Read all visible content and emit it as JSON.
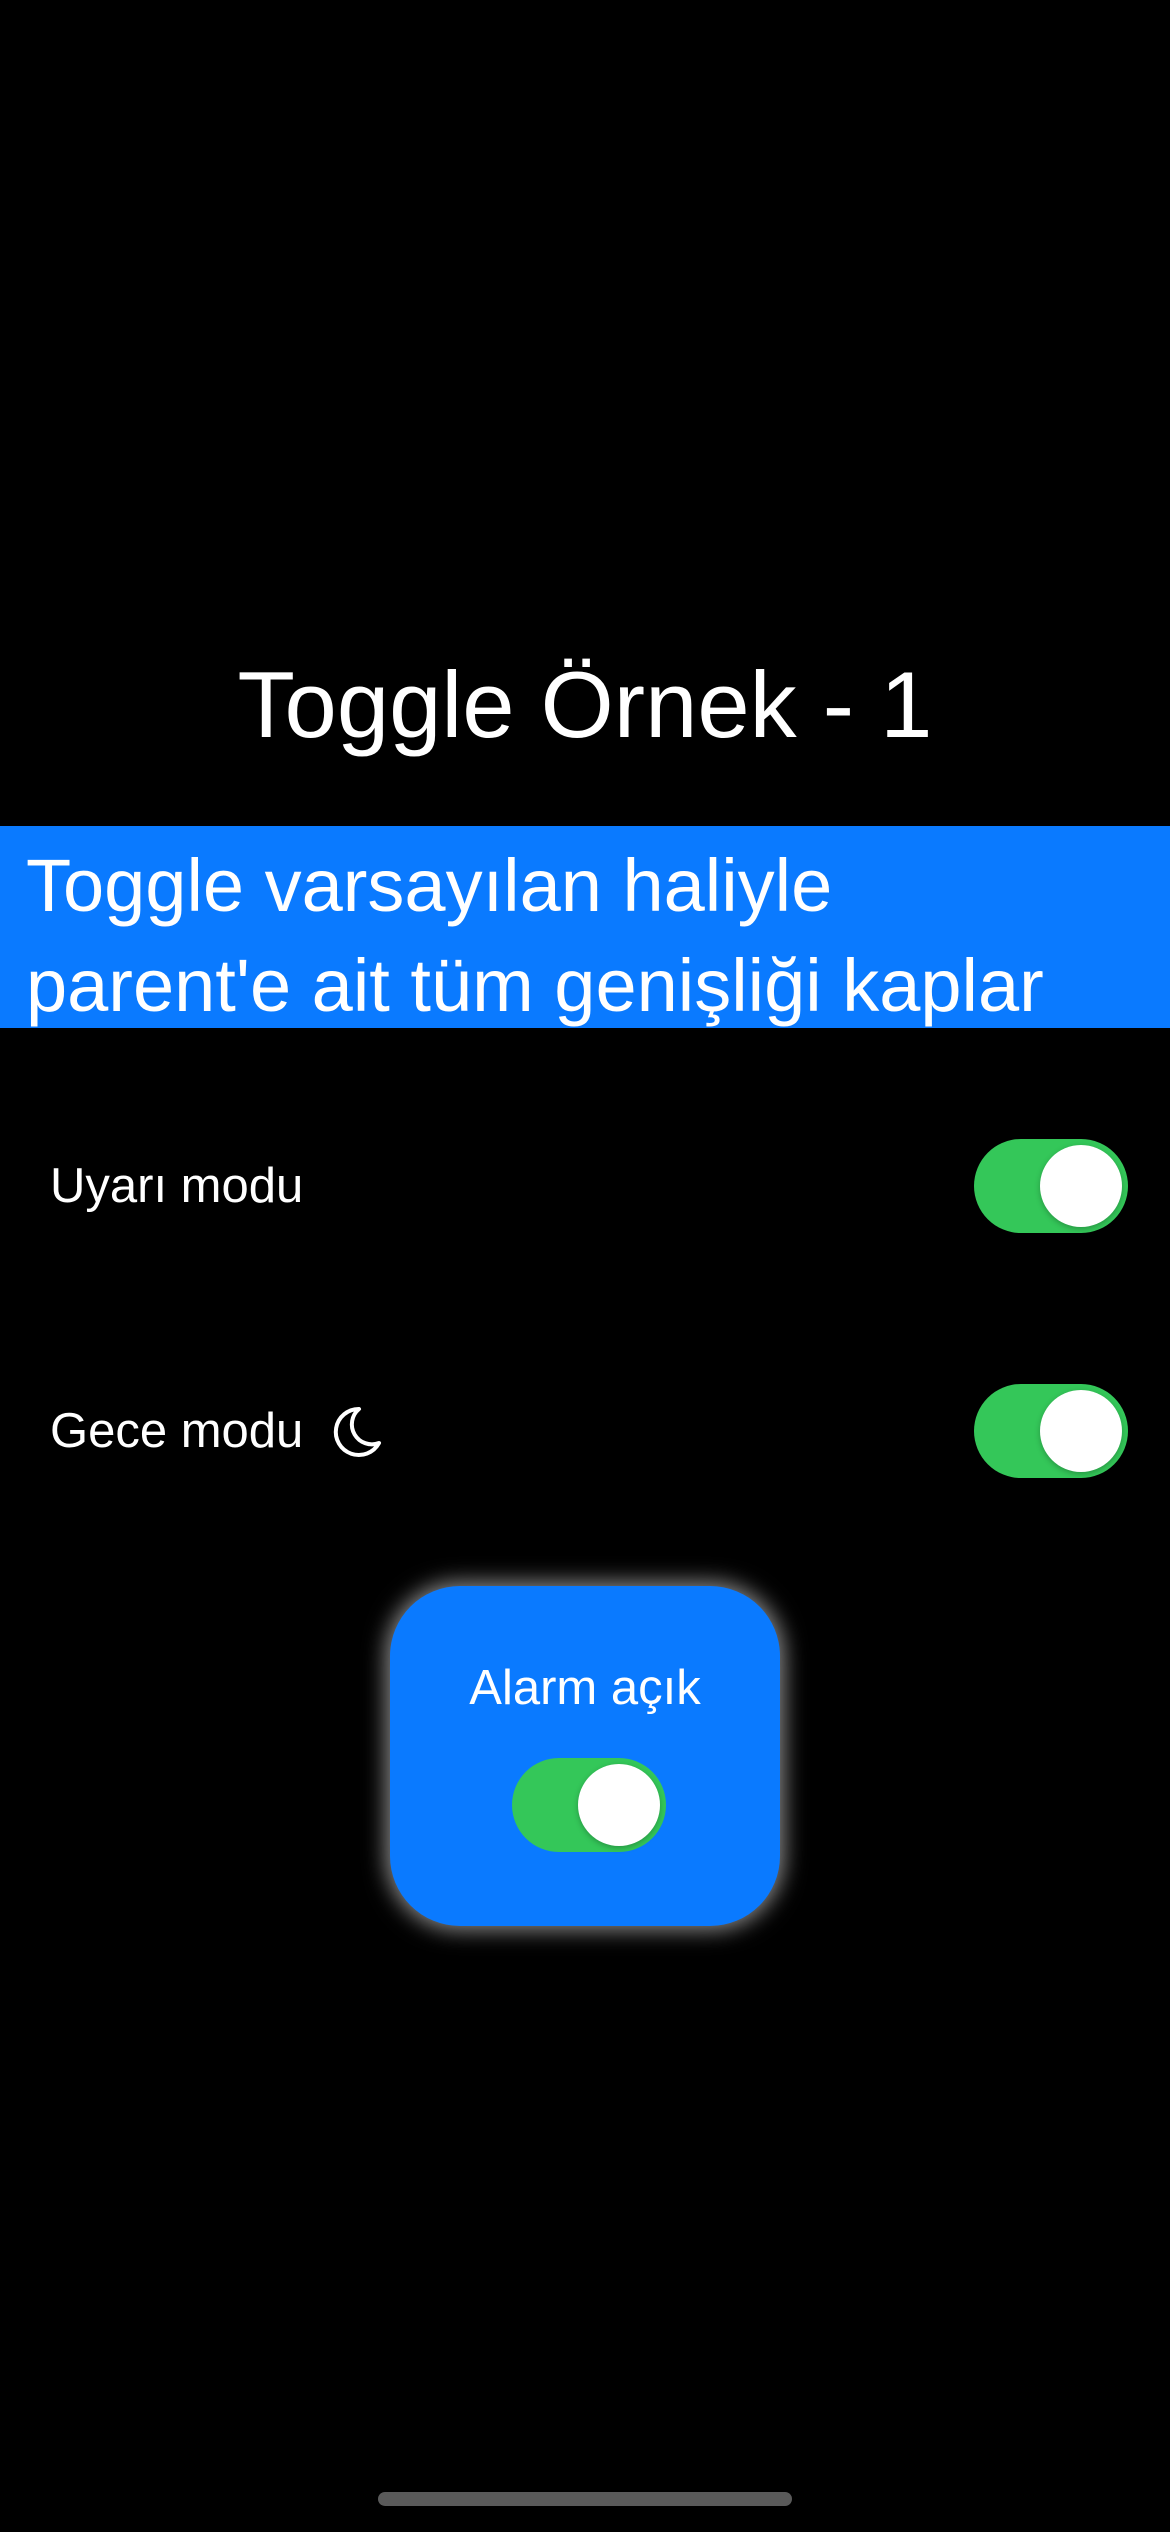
{
  "page": {
    "title": "Toggle Örnek - 1"
  },
  "banner": {
    "line1": "Toggle varsayılan haliyle",
    "line2": "parent'e ait tüm genişliği kaplar",
    "background_color": "#0a7aff"
  },
  "settings": [
    {
      "label": "Uyarı modu",
      "is_on": true
    },
    {
      "label": "Gece modu",
      "icon": "moon-icon",
      "is_on": true
    }
  ],
  "alarm_card": {
    "label": "Alarm açık",
    "is_on": true,
    "background_color": "#0a7aff"
  },
  "colors": {
    "toggle_on": "#34c759",
    "background": "#000000",
    "text": "#ffffff"
  }
}
